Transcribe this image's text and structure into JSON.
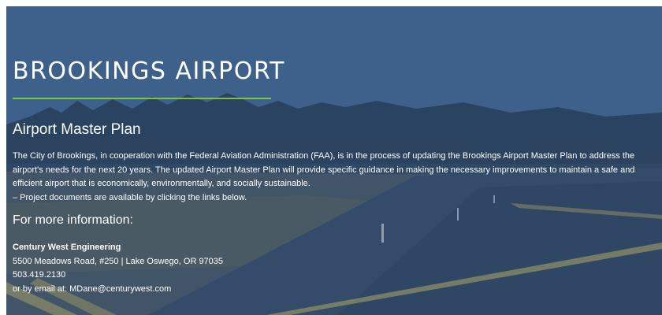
{
  "hero": {
    "title": "BROOKINGS AIRPORT",
    "accent_rule_color": "#7cc242",
    "section_title": "Airport Master Plan",
    "intro": "The City of Brookings, in cooperation with the Federal Aviation Administration (FAA), is in the process of updating the Brookings Airport Master Plan to address the airport's needs for the next 20 years. The updated Airport Master Plan will provide specific guidance in making the necessary improvements to maintain a safe and efficient airport that is economically, environmentally, and socially sustainable.",
    "note": "– Project documents are available by clicking the links below.",
    "more_heading": "For more information:",
    "contact": {
      "company": "Century West Engineering",
      "address": "5500 Meadows Road, #250 | Lake Oswego, OR 97035",
      "phone": "503.419.2130",
      "email_line": "or by email at: MDane@centurywest.com"
    }
  },
  "background": {
    "description_colors": {
      "sky": "#5b7ea3",
      "trees": "#2a3f4f",
      "runway": "#3b4f66",
      "runway_marking": "#d8c86a"
    }
  }
}
